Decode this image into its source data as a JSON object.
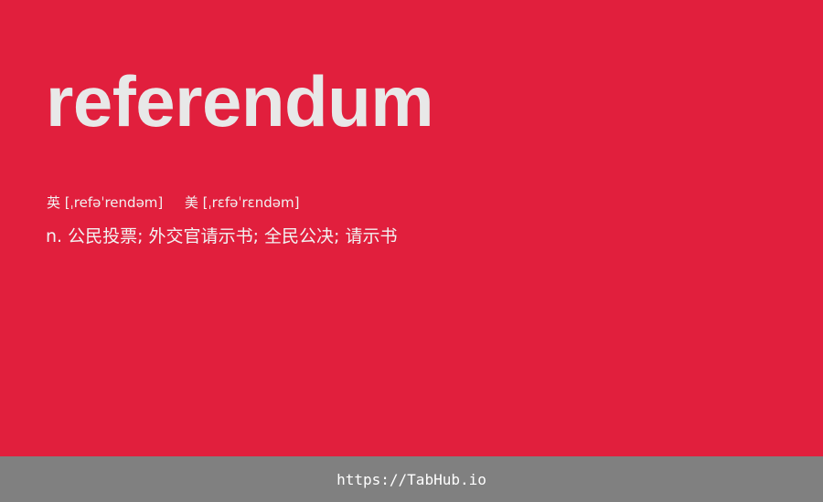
{
  "card": {
    "word": "referendum",
    "phonetic_uk_label": "英",
    "phonetic_uk": "[ˌrefəˈrendəm]",
    "phonetic_us_label": "美",
    "phonetic_us": "[ˌrɛfəˈrɛndəm]",
    "definition": "n. 公民投票; 外交官请示书; 全民公决; 请示书",
    "background_color": "#e11f3d"
  },
  "footer": {
    "url": "https://TabHub.io",
    "background_color": "#808080"
  }
}
